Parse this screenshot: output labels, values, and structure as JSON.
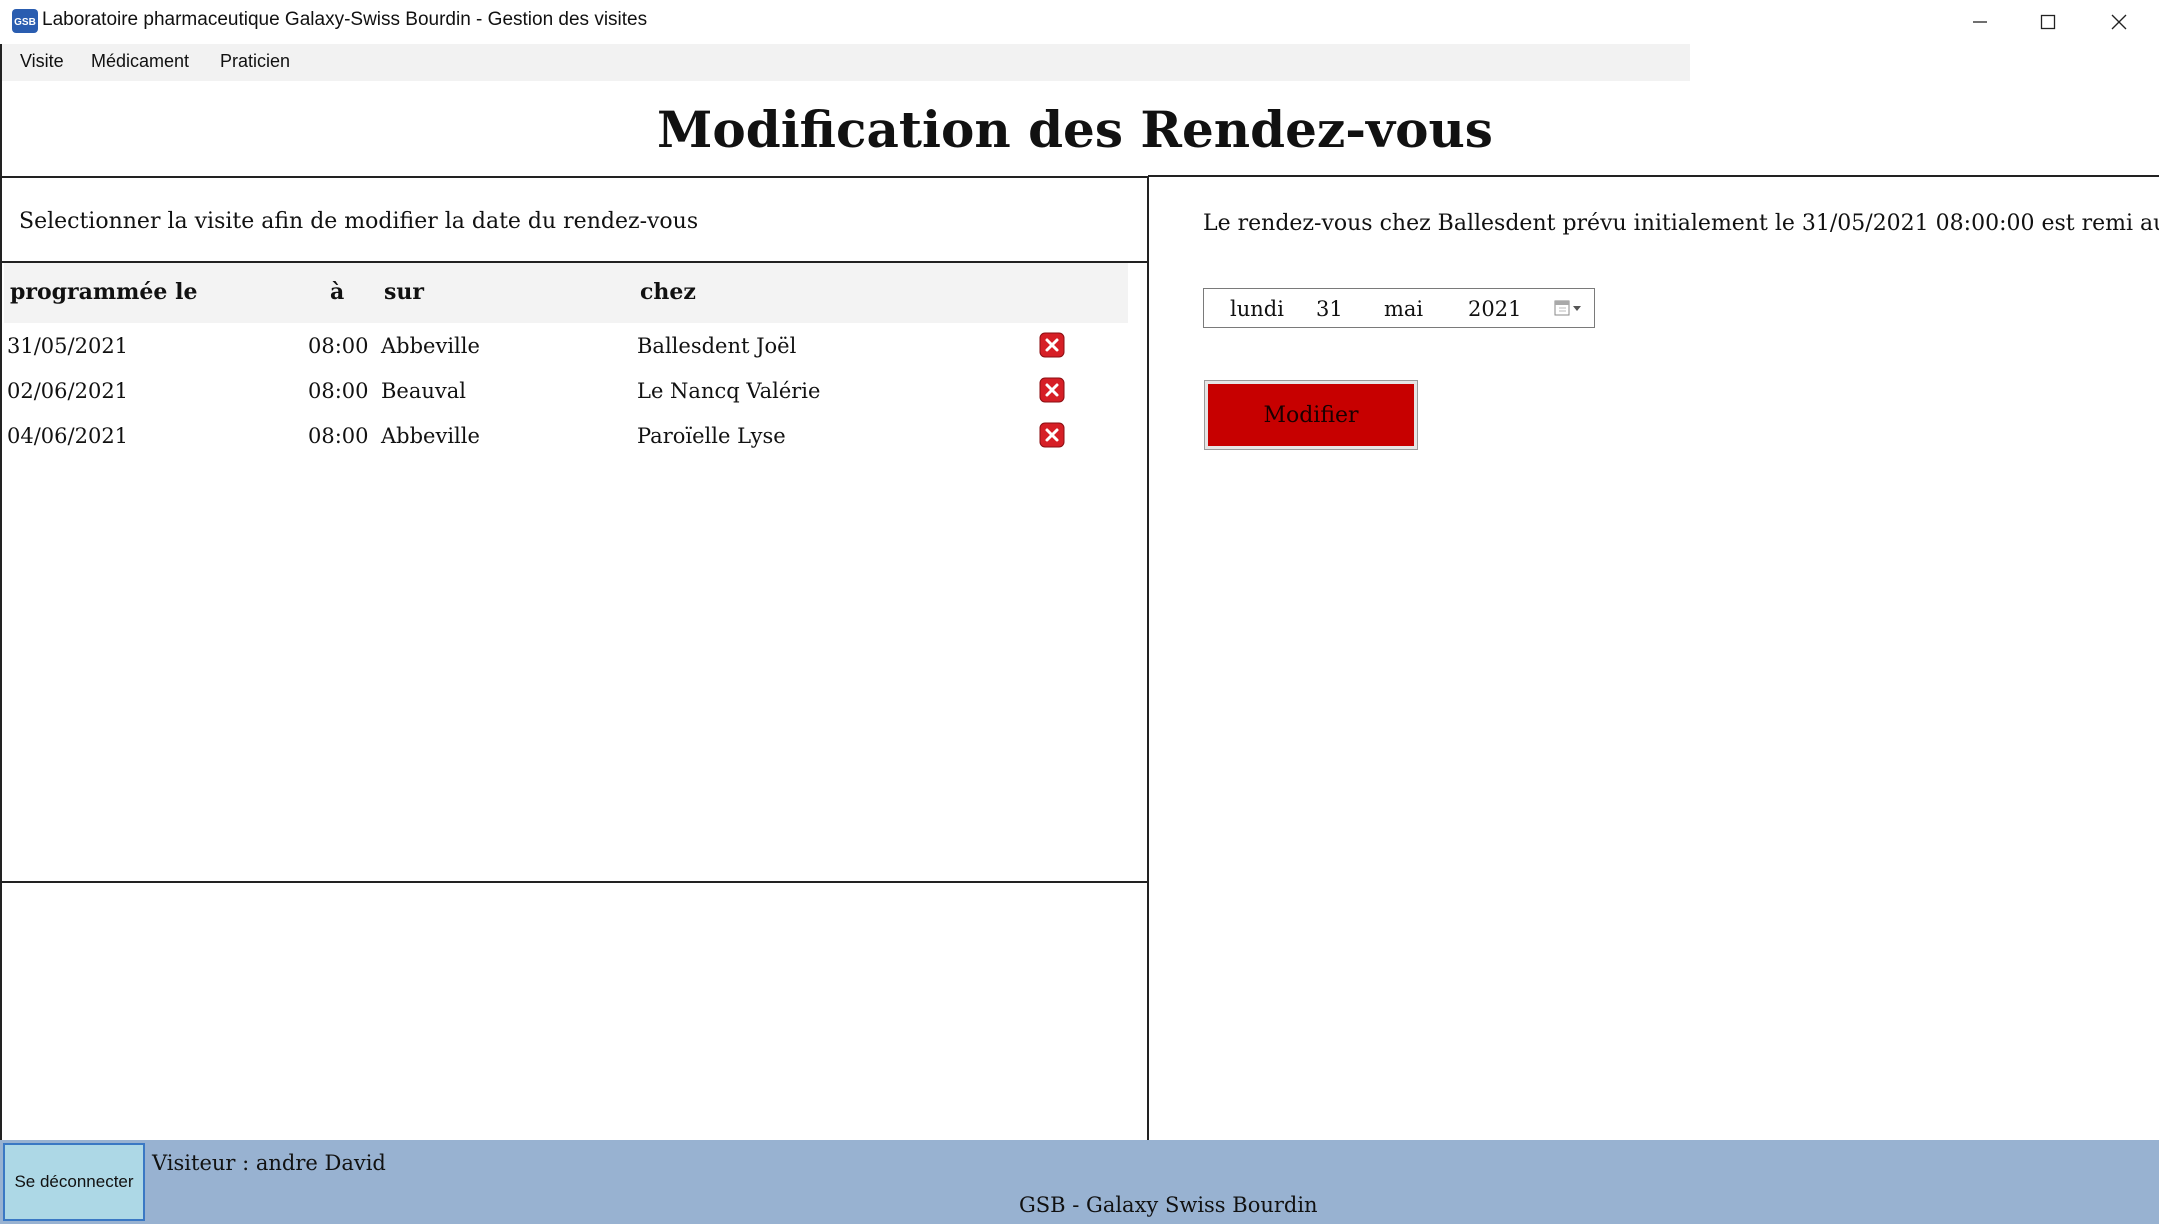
{
  "window": {
    "title": "Laboratoire pharmaceutique Galaxy-Swiss Bourdin - Gestion des visites",
    "icon_text": "GSB"
  },
  "menu": [
    {
      "label": "Visite"
    },
    {
      "label": "Médicament"
    },
    {
      "label": "Praticien"
    }
  ],
  "page_title": "Modification des Rendez-vous",
  "left_panel": {
    "instruction": "Selectionner la visite afin de modifier la date du rendez-vous",
    "columns": [
      "programmée le",
      "à",
      "sur",
      "chez"
    ],
    "rows": [
      {
        "date": "31/05/2021",
        "time": "08:00",
        "place": "Abbeville",
        "practitioner": "Ballesdent Joël"
      },
      {
        "date": "02/06/2021",
        "time": "08:00",
        "place": "Beauval",
        "practitioner": "Le Nancq Valérie"
      },
      {
        "date": "04/06/2021",
        "time": "08:00",
        "place": "Abbeville",
        "practitioner": "Paroïelle Lyse"
      }
    ],
    "delete_icon": "delete-x-icon"
  },
  "right_panel": {
    "notice": "Le rendez-vous chez Ballesdent prévu initialement le 31/05/2021 08:00:00 est remi au",
    "date_picker": {
      "weekday": "lundi",
      "day": "31",
      "month": "mai",
      "year": "2021"
    },
    "modify_label": "Modifier"
  },
  "footer": {
    "logout_label": "Se déconnecter",
    "visitor": "Visiteur : andre David",
    "brand": "GSB - Galaxy Swiss Bourdin"
  },
  "colors": {
    "modify_button": "#c70000",
    "footer_bg": "#98b2d1",
    "logout_bg": "#add8e6",
    "delete_icon": "#d61f26"
  }
}
